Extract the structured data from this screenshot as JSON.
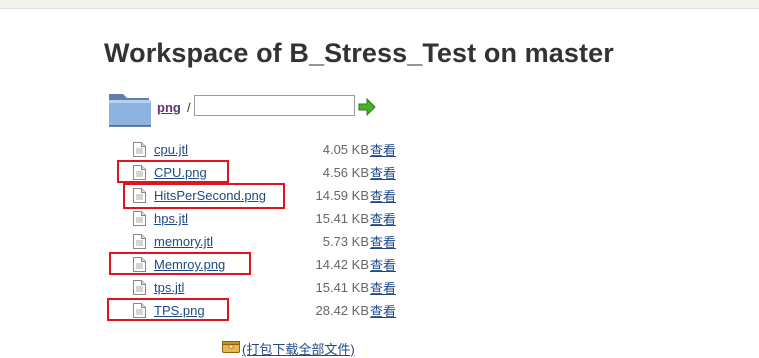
{
  "page": {
    "title": "Workspace of B_Stress_Test on master"
  },
  "path": {
    "crumb": "png",
    "separator": "/",
    "input_value": "",
    "go_icon": "green-arrow-icon",
    "folder_icon": "folder-icon"
  },
  "files": [
    {
      "name": "cpu.jtl",
      "size": "4.05 KB",
      "view": "查看",
      "highlighted": false
    },
    {
      "name": "CPU.png",
      "size": "4.56 KB",
      "view": "查看",
      "highlighted": true
    },
    {
      "name": "HitsPerSecond.png",
      "size": "14.59 KB",
      "view": "查看",
      "highlighted": true
    },
    {
      "name": "hps.jtl",
      "size": "15.41 KB",
      "view": "查看",
      "highlighted": false
    },
    {
      "name": "memory.jtl",
      "size": "5.73 KB",
      "view": "查看",
      "highlighted": false
    },
    {
      "name": "Memroy.png",
      "size": "14.42 KB",
      "view": "查看",
      "highlighted": true
    },
    {
      "name": "tps.jtl",
      "size": "15.41 KB",
      "view": "查看",
      "highlighted": false
    },
    {
      "name": "TPS.png",
      "size": "28.42 KB",
      "view": "查看",
      "highlighted": true
    }
  ],
  "download": {
    "label": "(打包下载全部文件)",
    "icon": "archive-icon"
  },
  "colors": {
    "highlight": "#e0141e",
    "link": "#204a87",
    "crumb": "#5c3566",
    "title": "#333333"
  }
}
